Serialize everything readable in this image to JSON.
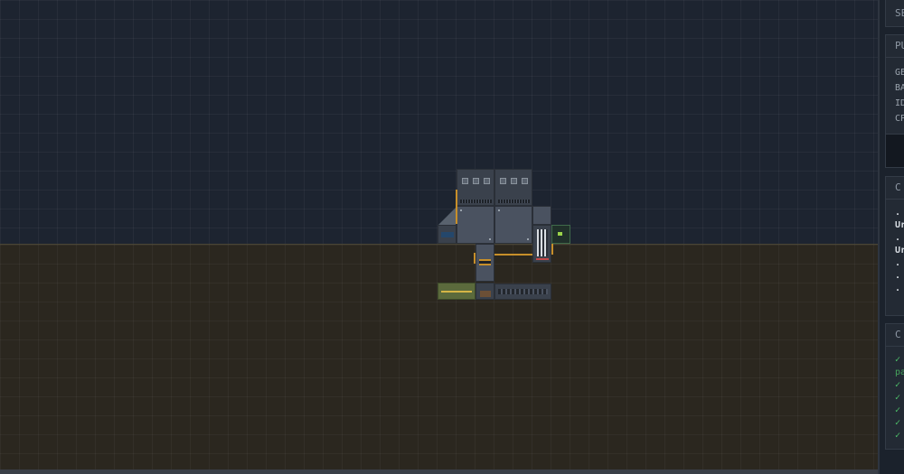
{
  "panel": {
    "section_top": {
      "title": "SE"
    },
    "section_stats": {
      "title": "PU",
      "rows": [
        "GE",
        "BA",
        "ID",
        "CP"
      ]
    },
    "section_log": {
      "title": "C",
      "rows": [
        ".",
        "Ur",
        ".",
        "Ur",
        ".",
        ".",
        "."
      ]
    },
    "section_checks": {
      "title": "C",
      "rows": [
        "✓",
        "pa",
        "✓",
        "✓",
        "✓",
        "✓",
        "✓"
      ]
    }
  },
  "colors": {
    "pipe": "#c78f2a",
    "ok": "#4ec36a",
    "sky": "#1d2430",
    "ground": "#2b271f"
  }
}
